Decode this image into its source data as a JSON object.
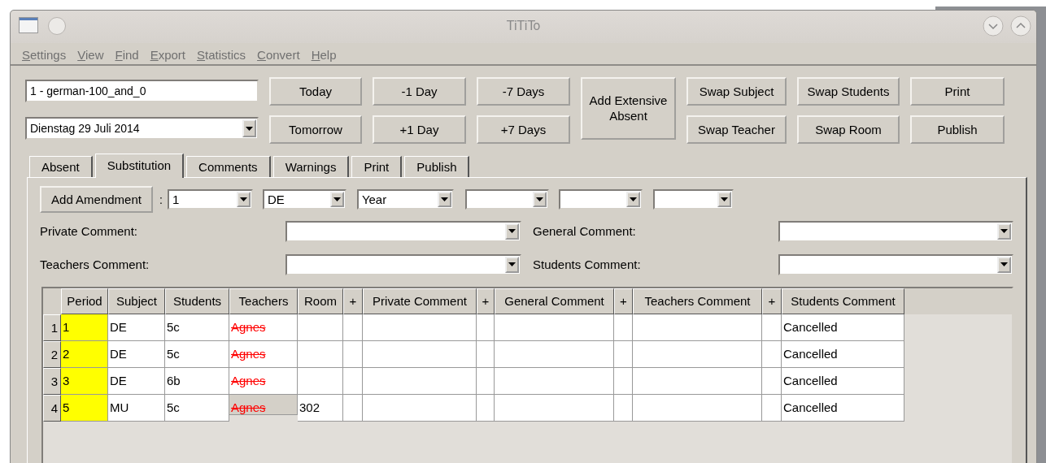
{
  "window": {
    "title": "TiTiTo"
  },
  "menu": [
    "Settings",
    "View",
    "Find",
    "Export",
    "Statistics",
    "Convert",
    "Help"
  ],
  "plan_field": {
    "value": "1 - german-100_and_0"
  },
  "date_select": {
    "value": "Dienstag 29 Juli 2014"
  },
  "button_columns": [
    {
      "kind": "pair",
      "buttons": [
        "Today",
        "Tomorrow"
      ]
    },
    {
      "kind": "pair",
      "buttons": [
        "-1 Day",
        "+1 Day"
      ]
    },
    {
      "kind": "pair",
      "buttons": [
        "-7 Days",
        "+7 Days"
      ]
    },
    {
      "kind": "single",
      "buttons": [
        "Add Extensive Absent"
      ]
    },
    {
      "kind": "pair",
      "buttons": [
        "Swap Subject",
        "Swap Teacher"
      ]
    },
    {
      "kind": "pair",
      "buttons": [
        "Swap Students",
        "Swap Room"
      ]
    },
    {
      "kind": "pair",
      "buttons": [
        "Print",
        "Publish"
      ]
    }
  ],
  "tabs": [
    {
      "label": "Absent",
      "selected": false
    },
    {
      "label": "Substitution",
      "selected": true
    },
    {
      "label": "Comments",
      "selected": false
    },
    {
      "label": "Warnings",
      "selected": false
    },
    {
      "label": "Print",
      "selected": false
    },
    {
      "label": "Publish",
      "selected": false
    }
  ],
  "amendment": {
    "button": "Add Amendment",
    "separator": ":",
    "selects": [
      {
        "kind": "dropdown",
        "value": "1"
      },
      {
        "kind": "dropdown",
        "value": "DE"
      },
      {
        "kind": "dropdown",
        "value": "Year"
      },
      {
        "kind": "dropdown"
      },
      {
        "kind": "dropdown"
      },
      {
        "kind": "dropdown"
      }
    ]
  },
  "comments": [
    {
      "label": "Private Comment:"
    },
    {
      "label": "General Comment:"
    },
    {
      "label": "Teachers Comment:"
    },
    {
      "label": "Students Comment:"
    }
  ],
  "table": {
    "columns": [
      "Period",
      "Subject",
      "Students",
      "Teachers",
      "Room",
      "+",
      "Private Comment",
      "+",
      "General Comment",
      "+",
      "Teachers Comment",
      "+",
      "Students Comment"
    ],
    "rows": [
      {
        "header": "1",
        "cells": [
          {
            "text": "1",
            "highlighted": true,
            "selected": false
          },
          {
            "text": "DE",
            "selected": false
          },
          {
            "text": "5c",
            "selected": false
          },
          {
            "text": "Agnes",
            "struck": true,
            "selected": false
          },
          {
            "selected": false
          },
          {
            "selected": false
          },
          {
            "selected": false
          },
          {
            "selected": false
          },
          {
            "selected": false
          },
          {
            "selected": false
          },
          {
            "selected": false
          },
          {
            "selected": false
          },
          {
            "text": "Cancelled",
            "selected": false
          }
        ]
      },
      {
        "header": "2",
        "cells": [
          {
            "text": "2",
            "highlighted": true,
            "selected": false
          },
          {
            "text": "DE",
            "selected": false
          },
          {
            "text": "5c",
            "selected": false
          },
          {
            "text": "Agnes",
            "struck": true,
            "selected": false
          },
          {
            "selected": false
          },
          {
            "selected": false
          },
          {
            "selected": false
          },
          {
            "selected": false
          },
          {
            "selected": false
          },
          {
            "selected": false
          },
          {
            "selected": false
          },
          {
            "selected": false
          },
          {
            "text": "Cancelled",
            "selected": false
          }
        ]
      },
      {
        "header": "3",
        "cells": [
          {
            "text": "3",
            "highlighted": true,
            "selected": false
          },
          {
            "text": "DE",
            "selected": false
          },
          {
            "text": "6b",
            "selected": false
          },
          {
            "text": "Agnes",
            "struck": true,
            "selected": false
          },
          {
            "selected": false
          },
          {
            "selected": false
          },
          {
            "selected": false
          },
          {
            "selected": false
          },
          {
            "selected": false
          },
          {
            "selected": false
          },
          {
            "selected": false
          },
          {
            "selected": false
          },
          {
            "text": "Cancelled",
            "selected": false
          }
        ]
      },
      {
        "header": "4",
        "cells": [
          {
            "text": "5",
            "highlighted": true,
            "selected": false
          },
          {
            "text": "MU",
            "selected": false
          },
          {
            "text": "5c",
            "selected": false
          },
          {
            "text": "Agnes",
            "struck": true,
            "selected": true
          },
          {
            "text": "302",
            "selected": false
          },
          {
            "selected": false
          },
          {
            "selected": false
          },
          {
            "selected": false
          },
          {
            "selected": false
          },
          {
            "selected": false
          },
          {
            "selected": false
          },
          {
            "selected": false
          },
          {
            "text": "Cancelled",
            "selected": false
          }
        ]
      }
    ]
  }
}
